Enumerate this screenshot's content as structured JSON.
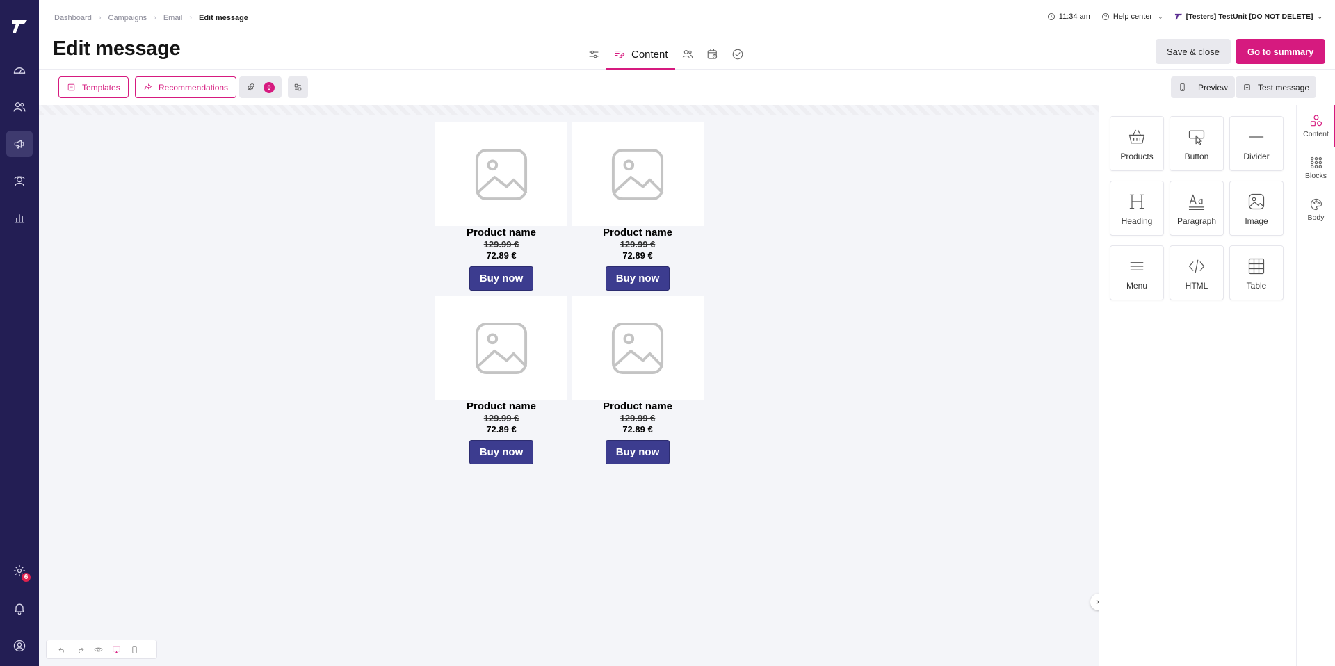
{
  "breadcrumb": [
    "Dashboard",
    "Campaigns",
    "Email",
    "Edit message"
  ],
  "page_title": "Edit message",
  "header": {
    "time": "11:34 am",
    "help": "Help center",
    "account": "[Testers] TestUnit [DO NOT DELETE]",
    "active_step": "Content",
    "save_close": "Save & close",
    "go_summary": "Go to summary"
  },
  "toolbar": {
    "templates": "Templates",
    "recommendations": "Recommendations",
    "attachments_count": "0",
    "preview": "Preview",
    "test_message": "Test message"
  },
  "products": [
    {
      "name": "Product name",
      "old_price": "129.99 €",
      "price": "72.89 €",
      "button": "Buy now"
    },
    {
      "name": "Product name",
      "old_price": "129.99 €",
      "price": "72.89 €",
      "button": "Buy now"
    },
    {
      "name": "Product name",
      "old_price": "129.99 €",
      "price": "72.89 €",
      "button": "Buy now"
    },
    {
      "name": "Product name",
      "old_price": "129.99 €",
      "price": "72.89 €",
      "button": "Buy now"
    }
  ],
  "tiles": [
    "Products",
    "Button",
    "Divider",
    "Heading",
    "Paragraph",
    "Image",
    "Menu",
    "HTML",
    "Table"
  ],
  "rail": [
    "Content",
    "Blocks",
    "Body"
  ],
  "notifications_badge": "6",
  "colors": {
    "nav_bg": "#231e54",
    "accent": "#d61a7f",
    "buy_button": "#3c3c8f"
  }
}
